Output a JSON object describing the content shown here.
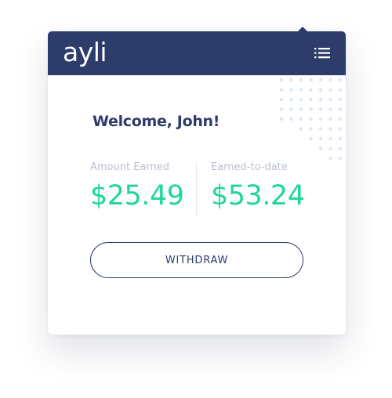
{
  "header": {
    "logo_text": "ayli",
    "menu_icon": "hamburger-menu-icon",
    "background_color": "#2e3c6b"
  },
  "welcome": {
    "text": "Welcome, John!"
  },
  "stats": [
    {
      "label": "Amount Earned",
      "value": "$25.49"
    },
    {
      "label": "Earned-to-date",
      "value": "$53.24"
    }
  ],
  "actions": {
    "withdraw_label": "WITHDRAW"
  },
  "colors": {
    "primary": "#2e3c6b",
    "accent_green": "#1fd69a",
    "muted_label": "#b9bfcf",
    "dot_pattern": "#d9e6f3"
  }
}
